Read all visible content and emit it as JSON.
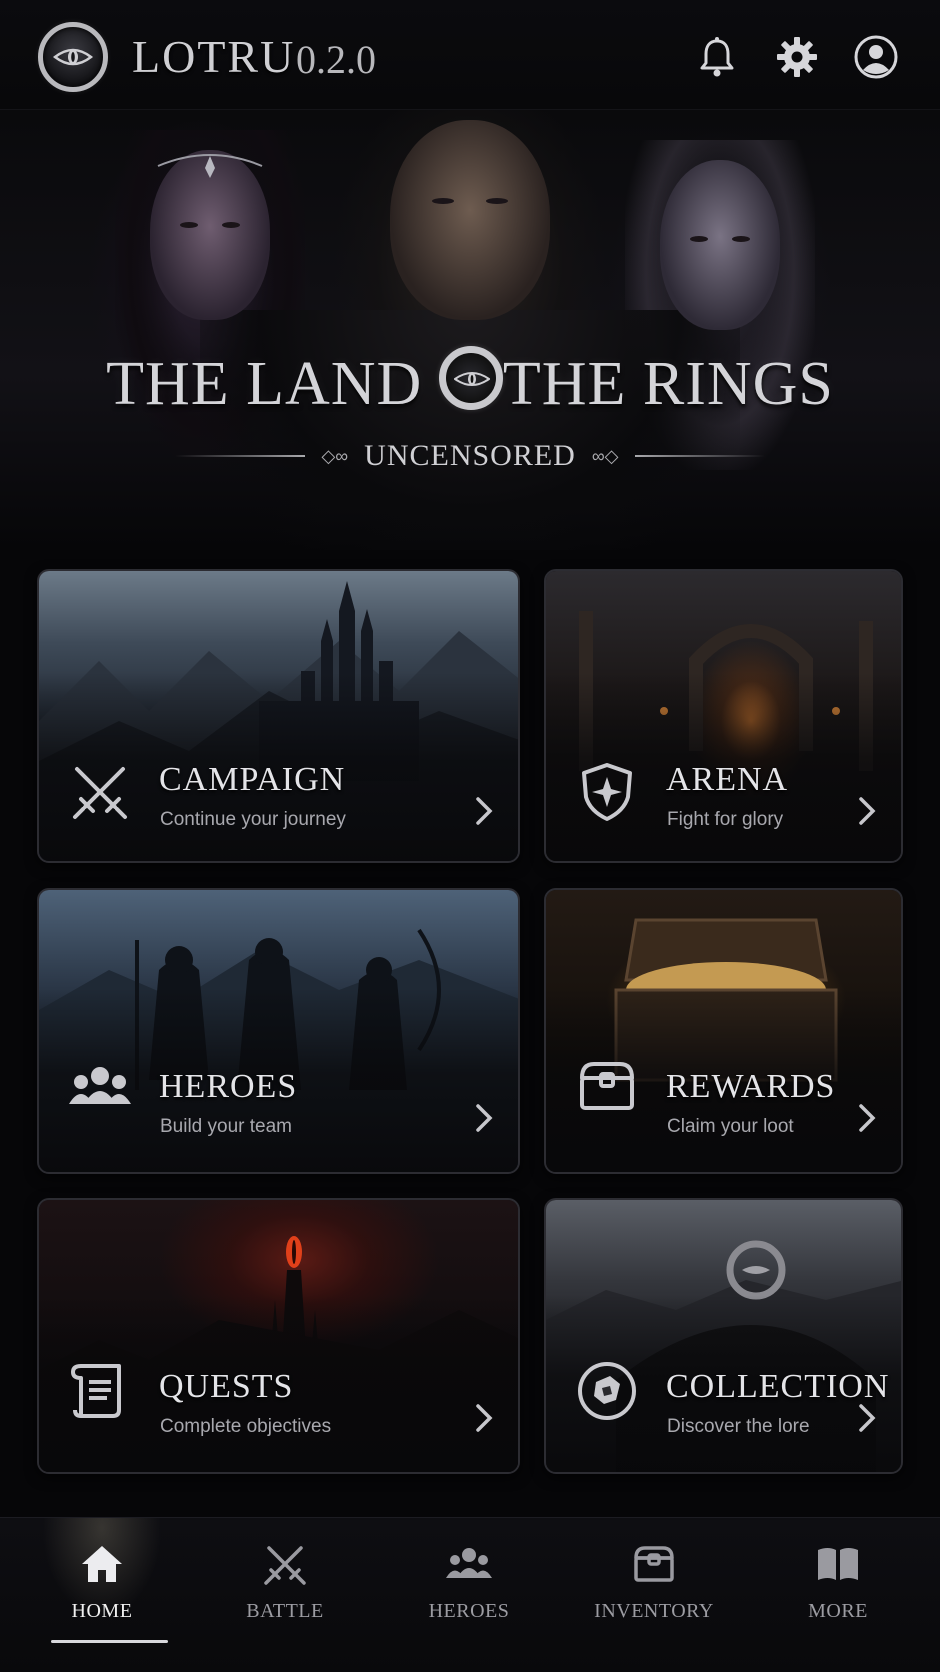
{
  "header": {
    "title": "LOTRU",
    "version": "0.2.0",
    "icons": [
      "eye-logo-icon",
      "bell-icon",
      "gear-icon",
      "user-profile-icon"
    ]
  },
  "hero": {
    "title_pre": "THE LAND ",
    "title_post": "THE RINGS",
    "subtitle": "UNCENSORED"
  },
  "cards": {
    "campaign": {
      "title": "CAMPAIGN",
      "subtitle": "Continue your journey",
      "icon": "crossed-swords-icon"
    },
    "arena": {
      "title": "ARENA",
      "subtitle": "Fight for glory",
      "icon": "shield-star-icon"
    },
    "heroes": {
      "title": "HEROES",
      "subtitle": "Build your team",
      "icon": "group-icon"
    },
    "rewards": {
      "title": "REWARDS",
      "subtitle": "Claim your loot",
      "icon": "treasure-chest-icon"
    },
    "quests": {
      "title": "QUESTS",
      "subtitle": "Complete objectives",
      "icon": "scroll-icon"
    },
    "collection": {
      "title": "COLLECTION",
      "subtitle": "Discover the lore",
      "icon": "map-medallion-icon"
    }
  },
  "nav": {
    "home": "HOME",
    "battle": "BATTLE",
    "heroes": "HEROES",
    "inventory": "INVENTORY",
    "more": "MORE",
    "active": "home"
  },
  "colors": {
    "background": "#060608",
    "card_border": "#2c2c32",
    "text_primary": "#e4e4e8",
    "text_secondary": "#a8a8ae",
    "sauron_eye": "#e0401a"
  }
}
